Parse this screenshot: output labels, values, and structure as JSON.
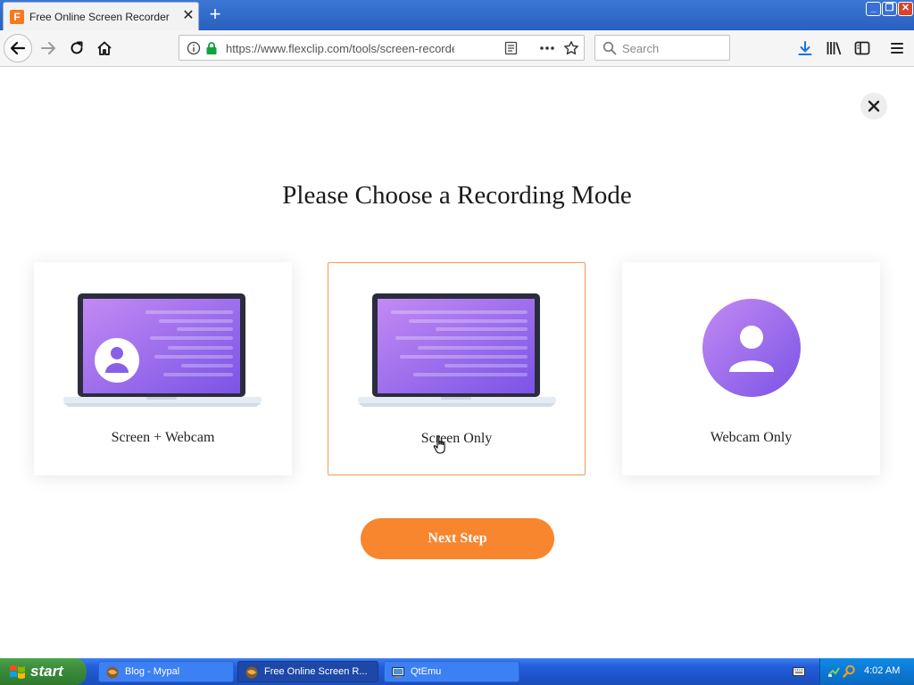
{
  "browser": {
    "tab": {
      "title": "Free Online Screen Recorder &",
      "favicon_letter": "F"
    },
    "url": "https://www.flexclip.com/tools/screen-recorder",
    "search_placeholder": "Search"
  },
  "page": {
    "heading": "Please Choose a Recording Mode",
    "modes": [
      {
        "label": "Screen + Webcam",
        "selected": false
      },
      {
        "label": "Screen Only",
        "selected": true
      },
      {
        "label": "Webcam Only",
        "selected": false
      }
    ],
    "next_button": "Next Step"
  },
  "taskbar": {
    "start_label": "start",
    "tasks": [
      {
        "label": "Blog - Mypal",
        "active": false
      },
      {
        "label": "Free Online Screen R...",
        "active": true
      },
      {
        "label": "QtEmu",
        "active": false
      }
    ],
    "clock": "4:02 AM"
  },
  "colors": {
    "accent_orange": "#f7862e",
    "selected_border": "#f39a52",
    "purple_light": "#b07cf2",
    "purple_dark": "#7b54e6",
    "titlebar_blue": "#2a60c0",
    "taskbar_blue": "#245edb"
  },
  "icons": {
    "favicon": "flexclip-icon",
    "back": "back-arrow-icon",
    "forward": "forward-arrow-icon",
    "reload": "reload-icon",
    "home": "home-icon",
    "info": "info-icon",
    "lock": "lock-icon",
    "reader": "reader-view-icon",
    "more": "more-icon",
    "bookmark": "star-icon",
    "search": "search-icon",
    "download": "download-icon",
    "library": "library-icon",
    "sidebar": "sidebar-icon",
    "menu": "menu-icon"
  }
}
